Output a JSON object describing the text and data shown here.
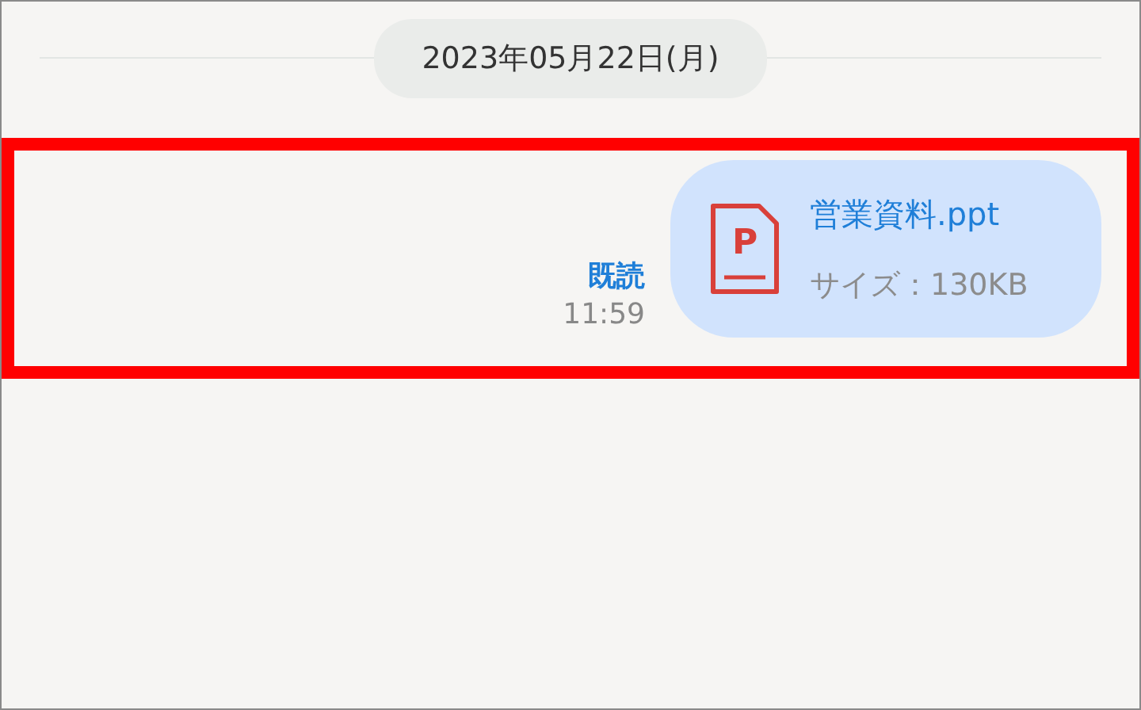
{
  "date_separator": "2023年05月22日(月)",
  "message": {
    "highlighted": true,
    "read_status": "既読",
    "time": "11:59",
    "file": {
      "kind": "ppt",
      "icon_letter": "P",
      "name": "営業資料.ppt",
      "size": "サイズ：130KB"
    }
  }
}
